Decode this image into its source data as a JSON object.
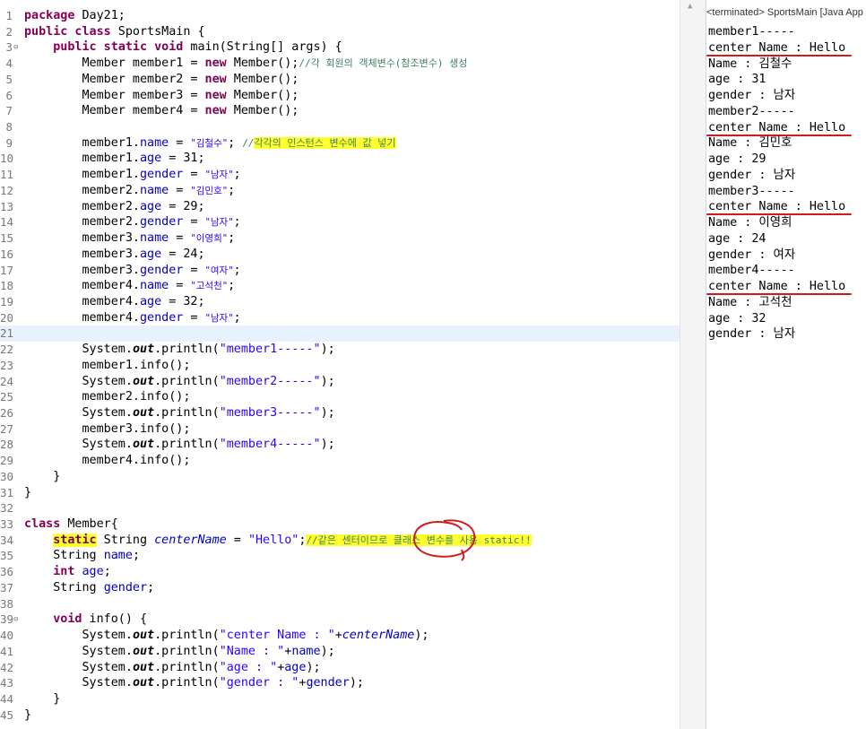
{
  "editor": {
    "lines": [
      {
        "n": "1",
        "parts": [
          {
            "t": "package",
            "c": "k"
          },
          {
            "t": " Day21;"
          }
        ]
      },
      {
        "n": "2",
        "parts": [
          {
            "t": "public class",
            "c": "k"
          },
          {
            "t": " SportsMain {"
          }
        ]
      },
      {
        "n": "3",
        "fold": true,
        "parts": [
          {
            "t": "    "
          },
          {
            "t": "public static void",
            "c": "k"
          },
          {
            "t": " main(String[] args) {"
          }
        ]
      },
      {
        "n": "4",
        "parts": [
          {
            "t": "        Member member1 = "
          },
          {
            "t": "new",
            "c": "k"
          },
          {
            "t": " Member();"
          },
          {
            "t": "//각 회원의 객체변수(참조변수) 생성",
            "c": "c"
          }
        ]
      },
      {
        "n": "5",
        "parts": [
          {
            "t": "        Member member2 = "
          },
          {
            "t": "new",
            "c": "k"
          },
          {
            "t": " Member();"
          }
        ]
      },
      {
        "n": "6",
        "parts": [
          {
            "t": "        Member member3 = "
          },
          {
            "t": "new",
            "c": "k"
          },
          {
            "t": " Member();"
          }
        ]
      },
      {
        "n": "7",
        "parts": [
          {
            "t": "        Member member4 = "
          },
          {
            "t": "new",
            "c": "k"
          },
          {
            "t": " Member();"
          }
        ]
      },
      {
        "n": "8",
        "parts": []
      },
      {
        "n": "9",
        "parts": [
          {
            "t": "        member1."
          },
          {
            "t": "name",
            "c": "f"
          },
          {
            "t": " = "
          },
          {
            "t": "\"김철수\"",
            "c": "s kr"
          },
          {
            "t": "; "
          },
          {
            "t": "//",
            "c": "c"
          },
          {
            "t": "각각의 인스턴스 변수에 값 넣기",
            "c": "c mark"
          }
        ]
      },
      {
        "n": "10",
        "parts": [
          {
            "t": "        member1."
          },
          {
            "t": "age",
            "c": "f"
          },
          {
            "t": " = 31;"
          }
        ]
      },
      {
        "n": "11",
        "parts": [
          {
            "t": "        member1."
          },
          {
            "t": "gender",
            "c": "f"
          },
          {
            "t": " = "
          },
          {
            "t": "\"남자\"",
            "c": "s kr"
          },
          {
            "t": ";"
          }
        ]
      },
      {
        "n": "12",
        "parts": [
          {
            "t": "        member2."
          },
          {
            "t": "name",
            "c": "f"
          },
          {
            "t": " = "
          },
          {
            "t": "\"김민호\"",
            "c": "s kr"
          },
          {
            "t": ";"
          }
        ]
      },
      {
        "n": "13",
        "parts": [
          {
            "t": "        member2."
          },
          {
            "t": "age",
            "c": "f"
          },
          {
            "t": " = 29;"
          }
        ]
      },
      {
        "n": "14",
        "parts": [
          {
            "t": "        member2."
          },
          {
            "t": "gender",
            "c": "f"
          },
          {
            "t": " = "
          },
          {
            "t": "\"남자\"",
            "c": "s kr"
          },
          {
            "t": ";"
          }
        ]
      },
      {
        "n": "15",
        "parts": [
          {
            "t": "        member3."
          },
          {
            "t": "name",
            "c": "f"
          },
          {
            "t": " = "
          },
          {
            "t": "\"이영희\"",
            "c": "s kr"
          },
          {
            "t": ";"
          }
        ]
      },
      {
        "n": "16",
        "parts": [
          {
            "t": "        member3."
          },
          {
            "t": "age",
            "c": "f"
          },
          {
            "t": " = 24;"
          }
        ]
      },
      {
        "n": "17",
        "parts": [
          {
            "t": "        member3."
          },
          {
            "t": "gender",
            "c": "f"
          },
          {
            "t": " = "
          },
          {
            "t": "\"여자\"",
            "c": "s kr"
          },
          {
            "t": ";"
          }
        ]
      },
      {
        "n": "18",
        "parts": [
          {
            "t": "        member4."
          },
          {
            "t": "name",
            "c": "f"
          },
          {
            "t": " = "
          },
          {
            "t": "\"고석천\"",
            "c": "s kr"
          },
          {
            "t": ";"
          }
        ]
      },
      {
        "n": "19",
        "parts": [
          {
            "t": "        member4."
          },
          {
            "t": "age",
            "c": "f"
          },
          {
            "t": " = 32;"
          }
        ]
      },
      {
        "n": "20",
        "parts": [
          {
            "t": "        member4."
          },
          {
            "t": "gender",
            "c": "f"
          },
          {
            "t": " = "
          },
          {
            "t": "\"남자\"",
            "c": "s kr"
          },
          {
            "t": ";"
          }
        ]
      },
      {
        "n": "21",
        "current": true,
        "parts": []
      },
      {
        "n": "22",
        "parts": [
          {
            "t": "        System."
          },
          {
            "t": "out",
            "c": "st"
          },
          {
            "t": ".println("
          },
          {
            "t": "\"member1-----\"",
            "c": "s"
          },
          {
            "t": ");"
          }
        ]
      },
      {
        "n": "23",
        "parts": [
          {
            "t": "        member1.info();"
          }
        ]
      },
      {
        "n": "24",
        "parts": [
          {
            "t": "        System."
          },
          {
            "t": "out",
            "c": "st"
          },
          {
            "t": ".println("
          },
          {
            "t": "\"member2-----\"",
            "c": "s"
          },
          {
            "t": ");"
          }
        ]
      },
      {
        "n": "25",
        "parts": [
          {
            "t": "        member2.info();"
          }
        ]
      },
      {
        "n": "26",
        "parts": [
          {
            "t": "        System."
          },
          {
            "t": "out",
            "c": "st"
          },
          {
            "t": ".println("
          },
          {
            "t": "\"member3-----\"",
            "c": "s"
          },
          {
            "t": ");"
          }
        ]
      },
      {
        "n": "27",
        "parts": [
          {
            "t": "        member3.info();"
          }
        ]
      },
      {
        "n": "28",
        "parts": [
          {
            "t": "        System."
          },
          {
            "t": "out",
            "c": "st"
          },
          {
            "t": ".println("
          },
          {
            "t": "\"member4-----\"",
            "c": "s"
          },
          {
            "t": ");"
          }
        ]
      },
      {
        "n": "29",
        "parts": [
          {
            "t": "        member4.info();"
          }
        ]
      },
      {
        "n": "30",
        "parts": [
          {
            "t": "    }"
          }
        ]
      },
      {
        "n": "31",
        "parts": [
          {
            "t": "}"
          }
        ]
      },
      {
        "n": "32",
        "parts": []
      },
      {
        "n": "33",
        "parts": [
          {
            "t": "class",
            "c": "k"
          },
          {
            "t": " Member{"
          }
        ]
      },
      {
        "n": "34",
        "parts": [
          {
            "t": "    "
          },
          {
            "t": "static",
            "c": "k mark"
          },
          {
            "t": " String "
          },
          {
            "t": "centerName",
            "c": "sf"
          },
          {
            "t": " = "
          },
          {
            "t": "\"Hello\"",
            "c": "s"
          },
          {
            "t": ";"
          },
          {
            "t": "//같은 센터이므로 클래스 변수를 사용 static!!",
            "c": "c mark"
          }
        ]
      },
      {
        "n": "35",
        "parts": [
          {
            "t": "    String "
          },
          {
            "t": "name",
            "c": "f"
          },
          {
            "t": ";"
          }
        ]
      },
      {
        "n": "36",
        "parts": [
          {
            "t": "    "
          },
          {
            "t": "int",
            "c": "k"
          },
          {
            "t": " "
          },
          {
            "t": "age",
            "c": "f"
          },
          {
            "t": ";"
          }
        ]
      },
      {
        "n": "37",
        "parts": [
          {
            "t": "    String "
          },
          {
            "t": "gender",
            "c": "f"
          },
          {
            "t": ";"
          }
        ]
      },
      {
        "n": "38",
        "parts": []
      },
      {
        "n": "39",
        "fold": true,
        "parts": [
          {
            "t": "    "
          },
          {
            "t": "void",
            "c": "k"
          },
          {
            "t": " info() {"
          }
        ]
      },
      {
        "n": "40",
        "parts": [
          {
            "t": "        System."
          },
          {
            "t": "out",
            "c": "st"
          },
          {
            "t": ".println("
          },
          {
            "t": "\"center Name : \"",
            "c": "s"
          },
          {
            "t": "+"
          },
          {
            "t": "centerName",
            "c": "sf"
          },
          {
            "t": ");"
          }
        ]
      },
      {
        "n": "41",
        "parts": [
          {
            "t": "        System."
          },
          {
            "t": "out",
            "c": "st"
          },
          {
            "t": ".println("
          },
          {
            "t": "\"Name : \"",
            "c": "s"
          },
          {
            "t": "+"
          },
          {
            "t": "name",
            "c": "f"
          },
          {
            "t": ");"
          }
        ]
      },
      {
        "n": "42",
        "parts": [
          {
            "t": "        System."
          },
          {
            "t": "out",
            "c": "st"
          },
          {
            "t": ".println("
          },
          {
            "t": "\"age : \"",
            "c": "s"
          },
          {
            "t": "+"
          },
          {
            "t": "age",
            "c": "f"
          },
          {
            "t": ");"
          }
        ]
      },
      {
        "n": "43",
        "parts": [
          {
            "t": "        System."
          },
          {
            "t": "out",
            "c": "st"
          },
          {
            "t": ".println("
          },
          {
            "t": "\"gender : \"",
            "c": "s"
          },
          {
            "t": "+"
          },
          {
            "t": "gender",
            "c": "f"
          },
          {
            "t": ");"
          }
        ]
      },
      {
        "n": "44",
        "parts": [
          {
            "t": "    }"
          }
        ]
      },
      {
        "n": "45",
        "parts": [
          {
            "t": "}"
          }
        ]
      }
    ]
  },
  "console": {
    "header": "<terminated> SportsMain [Java App",
    "lines": [
      "member1-----",
      "center Name : Hello",
      "Name : 김철수",
      "age : 31",
      "gender : 남자",
      "member2-----",
      "center Name : Hello",
      "Name : 김민호",
      "age : 29",
      "gender : 남자",
      "member3-----",
      "center Name : Hello",
      "Name : 이영희",
      "age : 24",
      "gender : 여자",
      "member4-----",
      "center Name : Hello",
      "Name : 고석천",
      "age : 32",
      "gender : 남자"
    ]
  },
  "colors": {
    "keyword": "#7f0055",
    "string": "#2a00ff",
    "field": "#0000c0",
    "comment": "#3f7f5f",
    "highlight": "#ffff2e",
    "current_line": "#e8f2fe",
    "annotation_red": "#d01c1c"
  },
  "icons": {
    "fold": "fold-collapse-icon",
    "scroll_up": "scroll-up-arrow-icon"
  }
}
